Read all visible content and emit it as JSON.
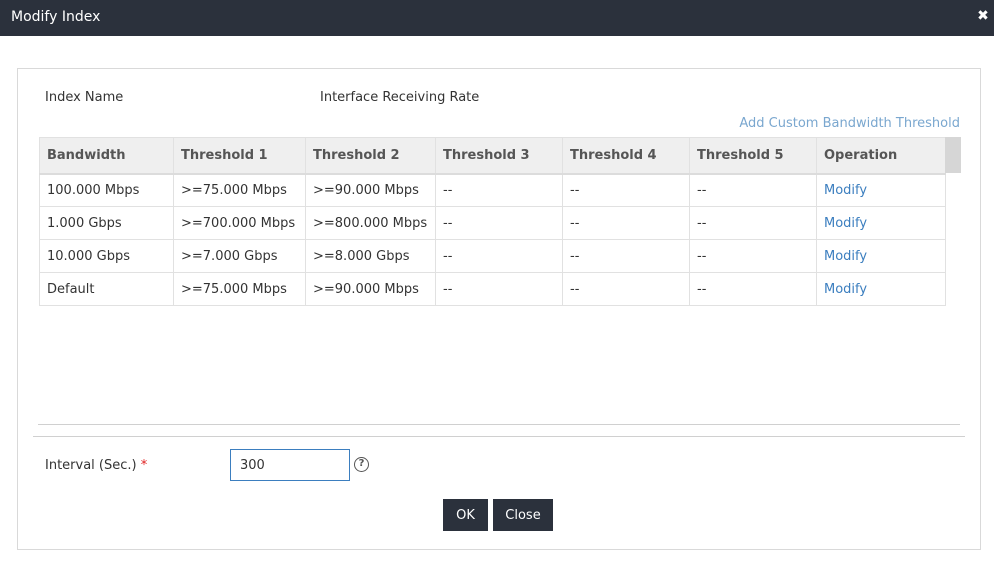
{
  "dialog": {
    "title": "Modify Index"
  },
  "index": {
    "label": "Index Name",
    "value": "Interface Receiving Rate"
  },
  "add_link": "Add Custom Bandwidth Threshold",
  "table": {
    "headers": [
      "Bandwidth",
      "Threshold 1",
      "Threshold 2",
      "Threshold 3",
      "Threshold 4",
      "Threshold 5",
      "Operation"
    ],
    "rows": [
      [
        "100.000 Mbps",
        ">=75.000 Mbps",
        ">=90.000 Mbps",
        "--",
        "--",
        "--",
        "Modify"
      ],
      [
        "1.000 Gbps",
        ">=700.000 Mbps",
        ">=800.000 Mbps",
        "--",
        "--",
        "--",
        "Modify"
      ],
      [
        "10.000 Gbps",
        ">=7.000 Gbps",
        ">=8.000 Gbps",
        "--",
        "--",
        "--",
        "Modify"
      ],
      [
        "Default",
        ">=75.000 Mbps",
        ">=90.000 Mbps",
        "--",
        "--",
        "--",
        "Modify"
      ]
    ]
  },
  "interval": {
    "label": "Interval (Sec.)",
    "required_mark": "*",
    "value": "300"
  },
  "buttons": {
    "ok": "OK",
    "close": "Close"
  },
  "icons": {
    "close": "close-icon",
    "help": "help-icon"
  }
}
